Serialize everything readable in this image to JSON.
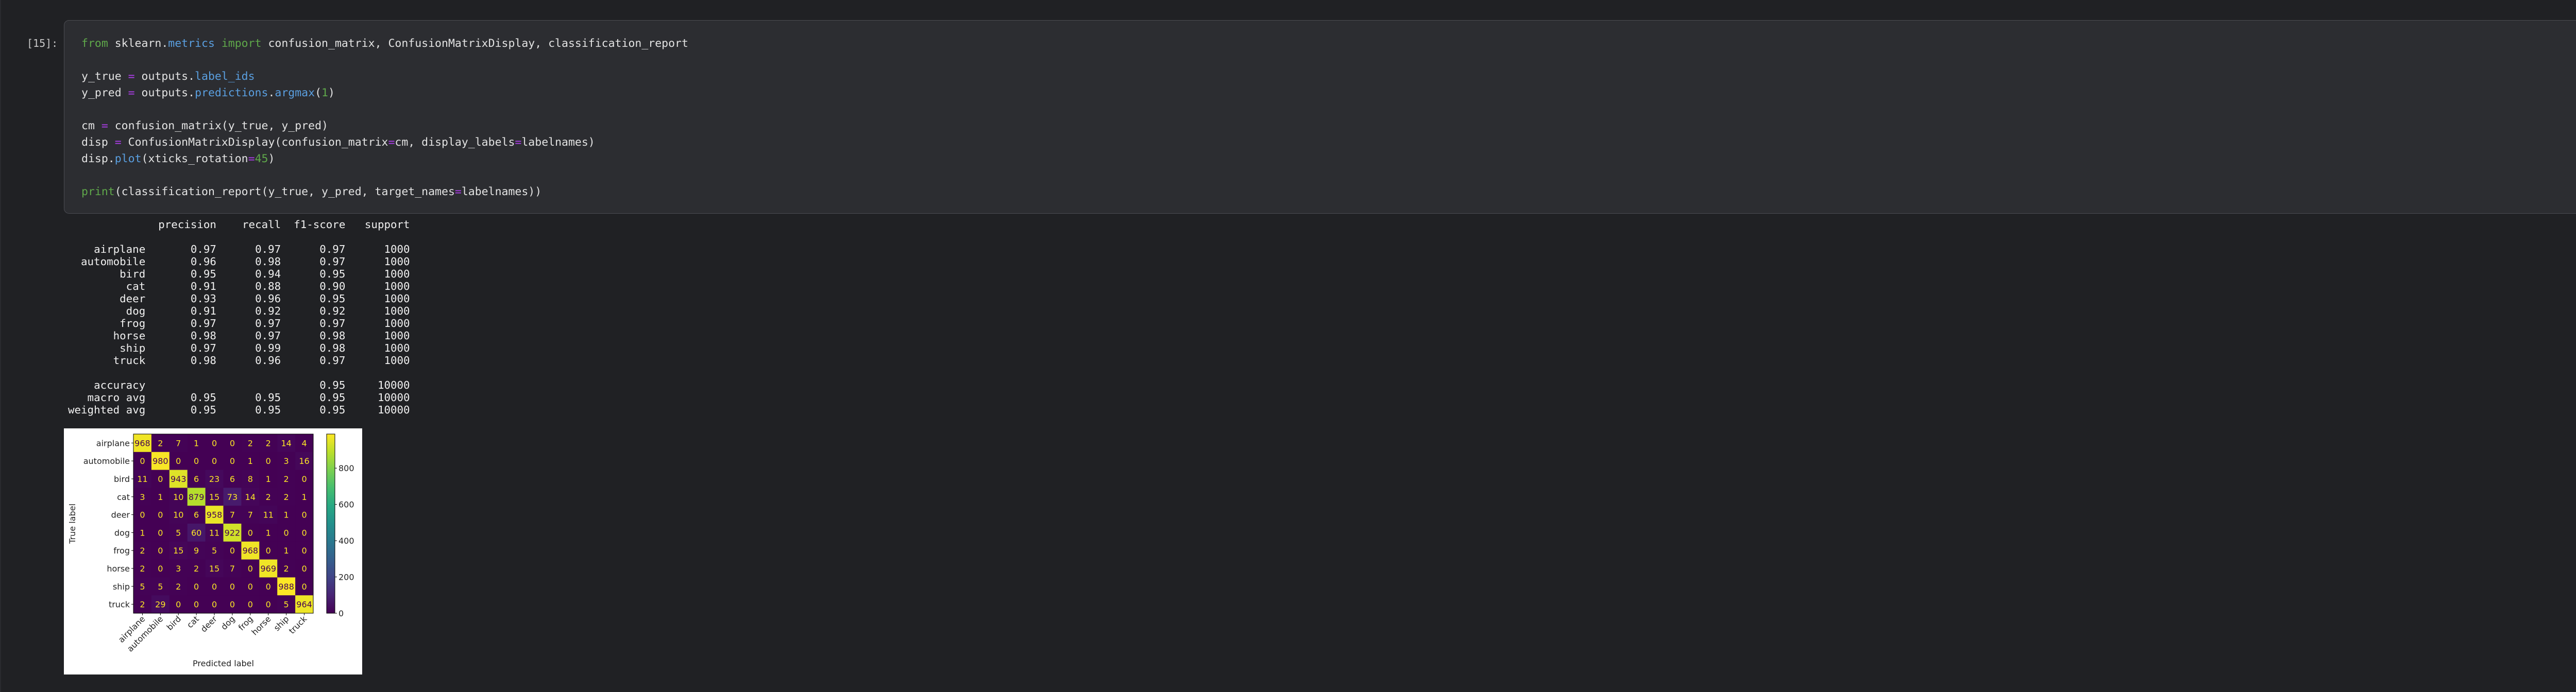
{
  "cell": {
    "prompt": "[15]:",
    "code_lines": [
      [
        [
          "from",
          "kw"
        ],
        [
          " sklearn.",
          ""
        ],
        [
          "metrics",
          "attr"
        ],
        [
          " ",
          ""
        ],
        [
          "import",
          "kw"
        ],
        [
          " confusion_matrix, ConfusionMatrixDisplay, classification_report",
          ""
        ]
      ],
      [],
      [
        [
          "y_true ",
          ""
        ],
        [
          "=",
          "op"
        ],
        [
          " outputs.",
          ""
        ],
        [
          "label_ids",
          "attr"
        ]
      ],
      [
        [
          "y_pred ",
          ""
        ],
        [
          "=",
          "op"
        ],
        [
          " outputs.",
          ""
        ],
        [
          "predictions",
          "attr"
        ],
        [
          ".",
          ""
        ],
        [
          "argmax",
          "attr"
        ],
        [
          "(",
          ""
        ],
        [
          "1",
          "num"
        ],
        [
          ")",
          ""
        ]
      ],
      [],
      [
        [
          "cm ",
          ""
        ],
        [
          "=",
          "op"
        ],
        [
          " confusion_matrix(y_true, y_pred)",
          ""
        ]
      ],
      [
        [
          "disp ",
          ""
        ],
        [
          "=",
          "op"
        ],
        [
          " ConfusionMatrixDisplay(confusion_matrix",
          ""
        ],
        [
          "=",
          "op"
        ],
        [
          "cm, display_labels",
          ""
        ],
        [
          "=",
          "op"
        ],
        [
          "labelnames)",
          ""
        ]
      ],
      [
        [
          "disp.",
          ""
        ],
        [
          "plot",
          "attr"
        ],
        [
          "(xticks_rotation",
          ""
        ],
        [
          "=",
          "op"
        ],
        [
          "45",
          "num"
        ],
        [
          ")",
          ""
        ]
      ],
      [],
      [
        [
          "print",
          "fn"
        ],
        [
          "(classification_report(y_true, y_pred, target_names",
          ""
        ],
        [
          "=",
          "op"
        ],
        [
          "labelnames))",
          ""
        ]
      ]
    ]
  },
  "report": {
    "headers": [
      "",
      "precision",
      "recall",
      "f1-score",
      "support"
    ],
    "rows": [
      [
        "airplane",
        "0.97",
        "0.97",
        "0.97",
        "1000"
      ],
      [
        "automobile",
        "0.96",
        "0.98",
        "0.97",
        "1000"
      ],
      [
        "bird",
        "0.95",
        "0.94",
        "0.95",
        "1000"
      ],
      [
        "cat",
        "0.91",
        "0.88",
        "0.90",
        "1000"
      ],
      [
        "deer",
        "0.93",
        "0.96",
        "0.95",
        "1000"
      ],
      [
        "dog",
        "0.91",
        "0.92",
        "0.92",
        "1000"
      ],
      [
        "frog",
        "0.97",
        "0.97",
        "0.97",
        "1000"
      ],
      [
        "horse",
        "0.98",
        "0.97",
        "0.98",
        "1000"
      ],
      [
        "ship",
        "0.97",
        "0.99",
        "0.98",
        "1000"
      ],
      [
        "truck",
        "0.98",
        "0.96",
        "0.97",
        "1000"
      ]
    ],
    "summary": [
      [
        "accuracy",
        "",
        "",
        "0.95",
        "10000"
      ],
      [
        "macro avg",
        "0.95",
        "0.95",
        "0.95",
        "10000"
      ],
      [
        "weighted avg",
        "0.95",
        "0.95",
        "0.95",
        "10000"
      ]
    ]
  },
  "chart_data": {
    "type": "heatmap",
    "title": "",
    "xlabel": "Predicted label",
    "ylabel": "True label",
    "labels": [
      "airplane",
      "automobile",
      "bird",
      "cat",
      "deer",
      "dog",
      "frog",
      "horse",
      "ship",
      "truck"
    ],
    "matrix": [
      [
        968,
        2,
        7,
        1,
        0,
        0,
        2,
        2,
        14,
        4
      ],
      [
        0,
        980,
        0,
        0,
        0,
        0,
        1,
        0,
        3,
        16
      ],
      [
        11,
        0,
        943,
        6,
        23,
        6,
        8,
        1,
        2,
        0
      ],
      [
        3,
        1,
        10,
        879,
        15,
        73,
        14,
        2,
        2,
        1
      ],
      [
        0,
        0,
        10,
        6,
        958,
        7,
        7,
        11,
        1,
        0
      ],
      [
        1,
        0,
        5,
        60,
        11,
        922,
        0,
        1,
        0,
        0
      ],
      [
        2,
        0,
        15,
        9,
        5,
        0,
        968,
        0,
        1,
        0
      ],
      [
        2,
        0,
        3,
        2,
        15,
        7,
        0,
        969,
        2,
        0
      ],
      [
        5,
        5,
        2,
        0,
        0,
        0,
        0,
        0,
        988,
        0
      ],
      [
        2,
        29,
        0,
        0,
        0,
        0,
        0,
        0,
        5,
        964
      ]
    ],
    "colorbar": {
      "min": 0,
      "max": 988,
      "ticks": [
        "0",
        "200",
        "400",
        "600",
        "800"
      ],
      "tick_values": [
        0,
        200,
        400,
        600,
        800
      ],
      "colormap": "viridis"
    },
    "xtick_rotation": 45
  }
}
